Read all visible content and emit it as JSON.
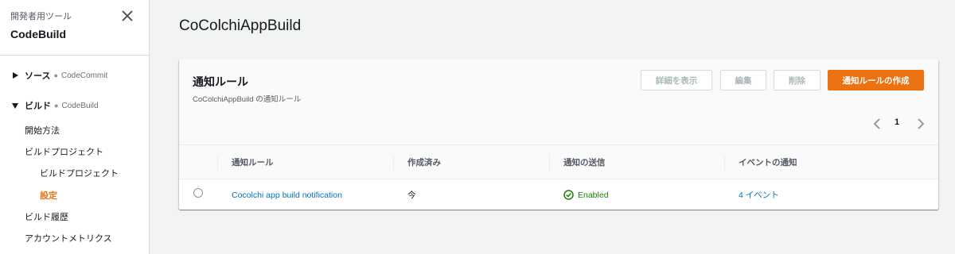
{
  "sidebar": {
    "tool_label": "開発者用ツール",
    "service_name": "CodeBuild",
    "sections": [
      {
        "name": "ソース",
        "sub": "CodeCommit",
        "expanded": false
      },
      {
        "name": "ビルド",
        "sub": "CodeBuild",
        "expanded": true
      }
    ],
    "build_items": [
      {
        "label": "開始方法",
        "level": 1,
        "active": false
      },
      {
        "label": "ビルドプロジェクト",
        "level": 1,
        "active": false
      },
      {
        "label": "ビルドプロジェクト",
        "level": 2,
        "active": false
      },
      {
        "label": "設定",
        "level": 2,
        "active": true
      },
      {
        "label": "ビルド履歴",
        "level": 1,
        "active": false
      },
      {
        "label": "アカウントメトリクス",
        "level": 1,
        "active": false
      }
    ]
  },
  "page": {
    "title": "CoColchiAppBuild"
  },
  "panel": {
    "title": "通知ルール",
    "description": "CoColchiAppBuild の通知ルール",
    "buttons": {
      "details": "詳細を表示",
      "edit": "編集",
      "delete": "削除",
      "create": "通知ルールの作成"
    },
    "pagination": {
      "current_page": "1"
    }
  },
  "table": {
    "columns": [
      "通知ルール",
      "作成済み",
      "通知の送信",
      "イベントの通知"
    ],
    "rows": [
      {
        "rule": "Cocolchi app build notification",
        "created": "今",
        "status": "Enabled",
        "events": "4 イベント"
      }
    ]
  },
  "colors": {
    "accent": "#ec7211",
    "link": "#0073bb",
    "success": "#1d8102"
  }
}
